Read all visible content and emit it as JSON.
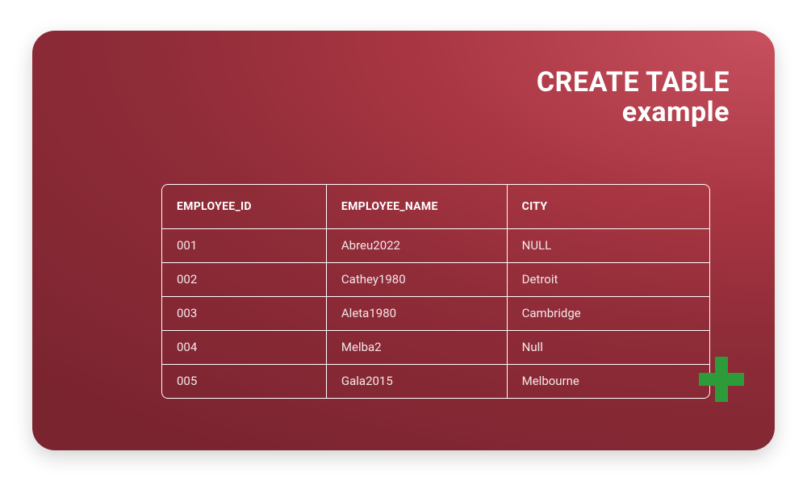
{
  "title": {
    "line1": "CREATE TABLE",
    "line2": "example"
  },
  "table": {
    "headers": [
      "EMPLOYEE_ID",
      "EMPLOYEE_NAME",
      "CITY"
    ],
    "rows": [
      [
        "001",
        "Abreu2022",
        "NULL"
      ],
      [
        "002",
        "Cathey1980",
        "Detroit"
      ],
      [
        "003",
        "Aleta1980",
        "Cambridge"
      ],
      [
        "004",
        "Melba2",
        "Null"
      ],
      [
        "005",
        "Gala2015",
        "Melbourne"
      ]
    ]
  },
  "icons": {
    "plus_color": "#2e9b3a"
  }
}
